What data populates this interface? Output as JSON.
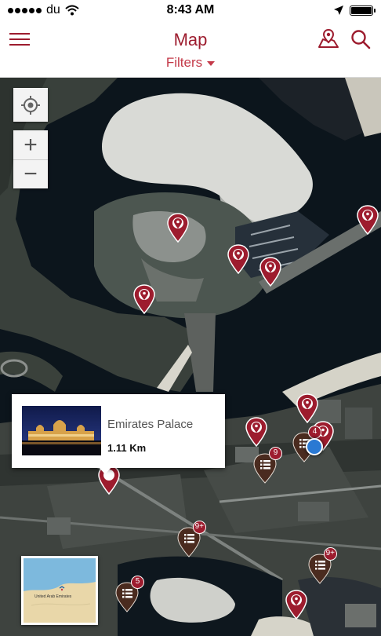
{
  "status_bar": {
    "carrier": "du",
    "time": "8:43 AM",
    "battery_level": 1.0
  },
  "header": {
    "title": "Map",
    "filters_label": "Filters",
    "accent_color": "#9d1c2e"
  },
  "map": {
    "zoom_in_label": "+",
    "zoom_out_label": "−",
    "clusters": [
      {
        "count": "4"
      },
      {
        "count": "9"
      },
      {
        "count": "9+"
      },
      {
        "count": "9+"
      },
      {
        "count": "5"
      }
    ],
    "info_card": {
      "name": "Emirates Palace",
      "distance": "1.11 Km"
    },
    "minimap": {
      "label": "United Arab Emirates"
    }
  }
}
